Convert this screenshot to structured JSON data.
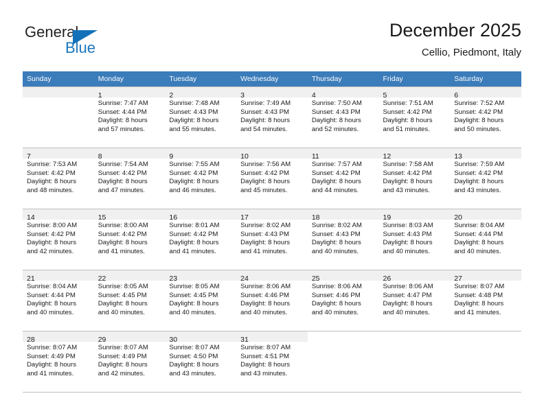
{
  "brand": {
    "name_top": "General",
    "name_bottom": "Blue",
    "triangle_color": "#1271b8",
    "blue_color": "#1b75bb"
  },
  "header": {
    "title": "December 2025",
    "subtitle": "Cellio, Piedmont, Italy"
  },
  "theme": {
    "header_band": "#3b7cba",
    "daynum_strip": "#f0f0f0",
    "grid_line": "#bfbfbf"
  },
  "weekday_headers": [
    "Sunday",
    "Monday",
    "Tuesday",
    "Wednesday",
    "Thursday",
    "Friday",
    "Saturday"
  ],
  "weeks": [
    [
      {
        "day": "",
        "lines": [
          "",
          "",
          "",
          ""
        ]
      },
      {
        "day": "1",
        "lines": [
          "Sunrise: 7:47 AM",
          "Sunset: 4:44 PM",
          "Daylight: 8 hours",
          "and 57 minutes."
        ]
      },
      {
        "day": "2",
        "lines": [
          "Sunrise: 7:48 AM",
          "Sunset: 4:43 PM",
          "Daylight: 8 hours",
          "and 55 minutes."
        ]
      },
      {
        "day": "3",
        "lines": [
          "Sunrise: 7:49 AM",
          "Sunset: 4:43 PM",
          "Daylight: 8 hours",
          "and 54 minutes."
        ]
      },
      {
        "day": "4",
        "lines": [
          "Sunrise: 7:50 AM",
          "Sunset: 4:43 PM",
          "Daylight: 8 hours",
          "and 52 minutes."
        ]
      },
      {
        "day": "5",
        "lines": [
          "Sunrise: 7:51 AM",
          "Sunset: 4:42 PM",
          "Daylight: 8 hours",
          "and 51 minutes."
        ]
      },
      {
        "day": "6",
        "lines": [
          "Sunrise: 7:52 AM",
          "Sunset: 4:42 PM",
          "Daylight: 8 hours",
          "and 50 minutes."
        ]
      }
    ],
    [
      {
        "day": "7",
        "lines": [
          "Sunrise: 7:53 AM",
          "Sunset: 4:42 PM",
          "Daylight: 8 hours",
          "and 48 minutes."
        ]
      },
      {
        "day": "8",
        "lines": [
          "Sunrise: 7:54 AM",
          "Sunset: 4:42 PM",
          "Daylight: 8 hours",
          "and 47 minutes."
        ]
      },
      {
        "day": "9",
        "lines": [
          "Sunrise: 7:55 AM",
          "Sunset: 4:42 PM",
          "Daylight: 8 hours",
          "and 46 minutes."
        ]
      },
      {
        "day": "10",
        "lines": [
          "Sunrise: 7:56 AM",
          "Sunset: 4:42 PM",
          "Daylight: 8 hours",
          "and 45 minutes."
        ]
      },
      {
        "day": "11",
        "lines": [
          "Sunrise: 7:57 AM",
          "Sunset: 4:42 PM",
          "Daylight: 8 hours",
          "and 44 minutes."
        ]
      },
      {
        "day": "12",
        "lines": [
          "Sunrise: 7:58 AM",
          "Sunset: 4:42 PM",
          "Daylight: 8 hours",
          "and 43 minutes."
        ]
      },
      {
        "day": "13",
        "lines": [
          "Sunrise: 7:59 AM",
          "Sunset: 4:42 PM",
          "Daylight: 8 hours",
          "and 43 minutes."
        ]
      }
    ],
    [
      {
        "day": "14",
        "lines": [
          "Sunrise: 8:00 AM",
          "Sunset: 4:42 PM",
          "Daylight: 8 hours",
          "and 42 minutes."
        ]
      },
      {
        "day": "15",
        "lines": [
          "Sunrise: 8:00 AM",
          "Sunset: 4:42 PM",
          "Daylight: 8 hours",
          "and 41 minutes."
        ]
      },
      {
        "day": "16",
        "lines": [
          "Sunrise: 8:01 AM",
          "Sunset: 4:42 PM",
          "Daylight: 8 hours",
          "and 41 minutes."
        ]
      },
      {
        "day": "17",
        "lines": [
          "Sunrise: 8:02 AM",
          "Sunset: 4:43 PM",
          "Daylight: 8 hours",
          "and 41 minutes."
        ]
      },
      {
        "day": "18",
        "lines": [
          "Sunrise: 8:02 AM",
          "Sunset: 4:43 PM",
          "Daylight: 8 hours",
          "and 40 minutes."
        ]
      },
      {
        "day": "19",
        "lines": [
          "Sunrise: 8:03 AM",
          "Sunset: 4:43 PM",
          "Daylight: 8 hours",
          "and 40 minutes."
        ]
      },
      {
        "day": "20",
        "lines": [
          "Sunrise: 8:04 AM",
          "Sunset: 4:44 PM",
          "Daylight: 8 hours",
          "and 40 minutes."
        ]
      }
    ],
    [
      {
        "day": "21",
        "lines": [
          "Sunrise: 8:04 AM",
          "Sunset: 4:44 PM",
          "Daylight: 8 hours",
          "and 40 minutes."
        ]
      },
      {
        "day": "22",
        "lines": [
          "Sunrise: 8:05 AM",
          "Sunset: 4:45 PM",
          "Daylight: 8 hours",
          "and 40 minutes."
        ]
      },
      {
        "day": "23",
        "lines": [
          "Sunrise: 8:05 AM",
          "Sunset: 4:45 PM",
          "Daylight: 8 hours",
          "and 40 minutes."
        ]
      },
      {
        "day": "24",
        "lines": [
          "Sunrise: 8:06 AM",
          "Sunset: 4:46 PM",
          "Daylight: 8 hours",
          "and 40 minutes."
        ]
      },
      {
        "day": "25",
        "lines": [
          "Sunrise: 8:06 AM",
          "Sunset: 4:46 PM",
          "Daylight: 8 hours",
          "and 40 minutes."
        ]
      },
      {
        "day": "26",
        "lines": [
          "Sunrise: 8:06 AM",
          "Sunset: 4:47 PM",
          "Daylight: 8 hours",
          "and 40 minutes."
        ]
      },
      {
        "day": "27",
        "lines": [
          "Sunrise: 8:07 AM",
          "Sunset: 4:48 PM",
          "Daylight: 8 hours",
          "and 41 minutes."
        ]
      }
    ],
    [
      {
        "day": "28",
        "lines": [
          "Sunrise: 8:07 AM",
          "Sunset: 4:49 PM",
          "Daylight: 8 hours",
          "and 41 minutes."
        ]
      },
      {
        "day": "29",
        "lines": [
          "Sunrise: 8:07 AM",
          "Sunset: 4:49 PM",
          "Daylight: 8 hours",
          "and 42 minutes."
        ]
      },
      {
        "day": "30",
        "lines": [
          "Sunrise: 8:07 AM",
          "Sunset: 4:50 PM",
          "Daylight: 8 hours",
          "and 43 minutes."
        ]
      },
      {
        "day": "31",
        "lines": [
          "Sunrise: 8:07 AM",
          "Sunset: 4:51 PM",
          "Daylight: 8 hours",
          "and 43 minutes."
        ]
      },
      {
        "day": "",
        "lines": [
          "",
          "",
          "",
          ""
        ]
      },
      {
        "day": "",
        "lines": [
          "",
          "",
          "",
          ""
        ]
      },
      {
        "day": "",
        "lines": [
          "",
          "",
          "",
          ""
        ]
      }
    ]
  ]
}
